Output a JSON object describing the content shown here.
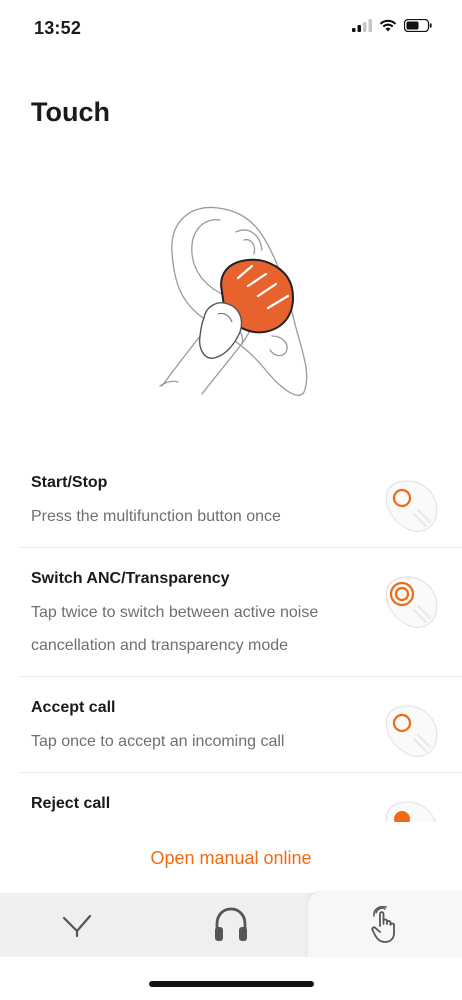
{
  "status": {
    "time": "13:52"
  },
  "page": {
    "title": "Touch"
  },
  "gestures": [
    {
      "title": "Start/Stop",
      "description": "Press the multifunction button once",
      "icon": "single-tap-icon"
    },
    {
      "title": "Switch ANC/Transparency",
      "description": "Tap twice to switch between active noise cancellation and transparency mode",
      "icon": "double-tap-icon"
    },
    {
      "title": "Accept call",
      "description": "Tap once to accept an incoming call",
      "icon": "single-tap-icon"
    },
    {
      "title": "Reject call",
      "description": "",
      "icon": "hold-icon"
    }
  ],
  "footer": {
    "manual_link": "Open manual online"
  },
  "tabs": [
    {
      "name": "logo-tab",
      "icon": "brand-logo-icon"
    },
    {
      "name": "headphones-tab",
      "icon": "headphones-icon"
    },
    {
      "name": "touch-tab",
      "icon": "touch-gesture-icon",
      "active": true
    }
  ],
  "colors": {
    "accent": "#f06a14",
    "text": "#1a1a1a",
    "secondary_text": "#6f6f6f",
    "tab_bar": "#efefef"
  }
}
